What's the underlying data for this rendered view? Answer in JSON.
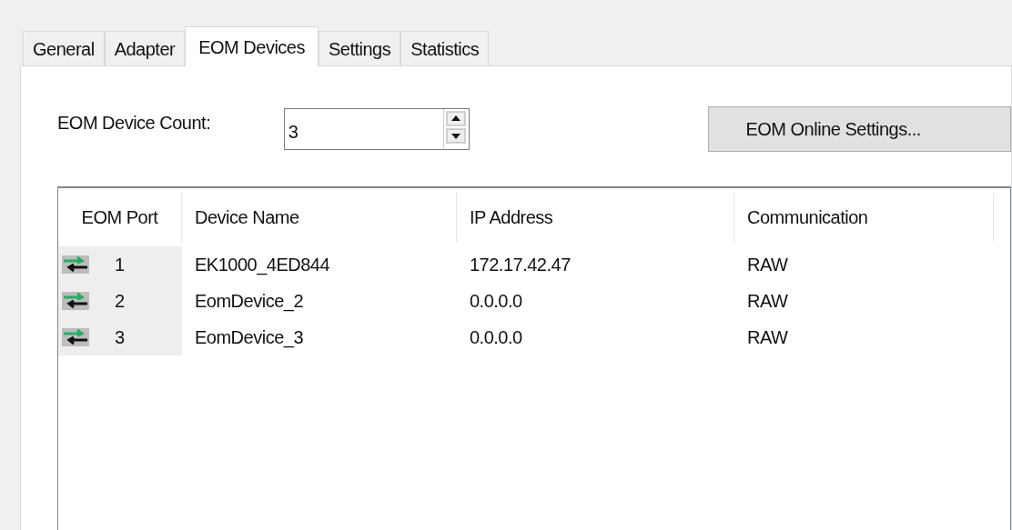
{
  "tabs": [
    {
      "label": "General",
      "selected": false
    },
    {
      "label": "Adapter",
      "selected": false
    },
    {
      "label": "EOM Devices",
      "selected": true
    },
    {
      "label": "Settings",
      "selected": false
    },
    {
      "label": "Statistics",
      "selected": false
    }
  ],
  "device_count": {
    "label": "EOM Device Count:",
    "value": "3"
  },
  "online_settings_button": "EOM Online Settings...",
  "table": {
    "columns": [
      "EOM Port",
      "Device Name",
      "IP Address",
      "Communication"
    ],
    "rows": [
      {
        "port": "1",
        "device_name": "EK1000_4ED844",
        "ip_address": "172.17.42.47",
        "communication": "RAW"
      },
      {
        "port": "2",
        "device_name": "EomDevice_2",
        "ip_address": "0.0.0.0",
        "communication": "RAW"
      },
      {
        "port": "3",
        "device_name": "EomDevice_3",
        "ip_address": "0.0.0.0",
        "communication": "RAW"
      }
    ]
  }
}
